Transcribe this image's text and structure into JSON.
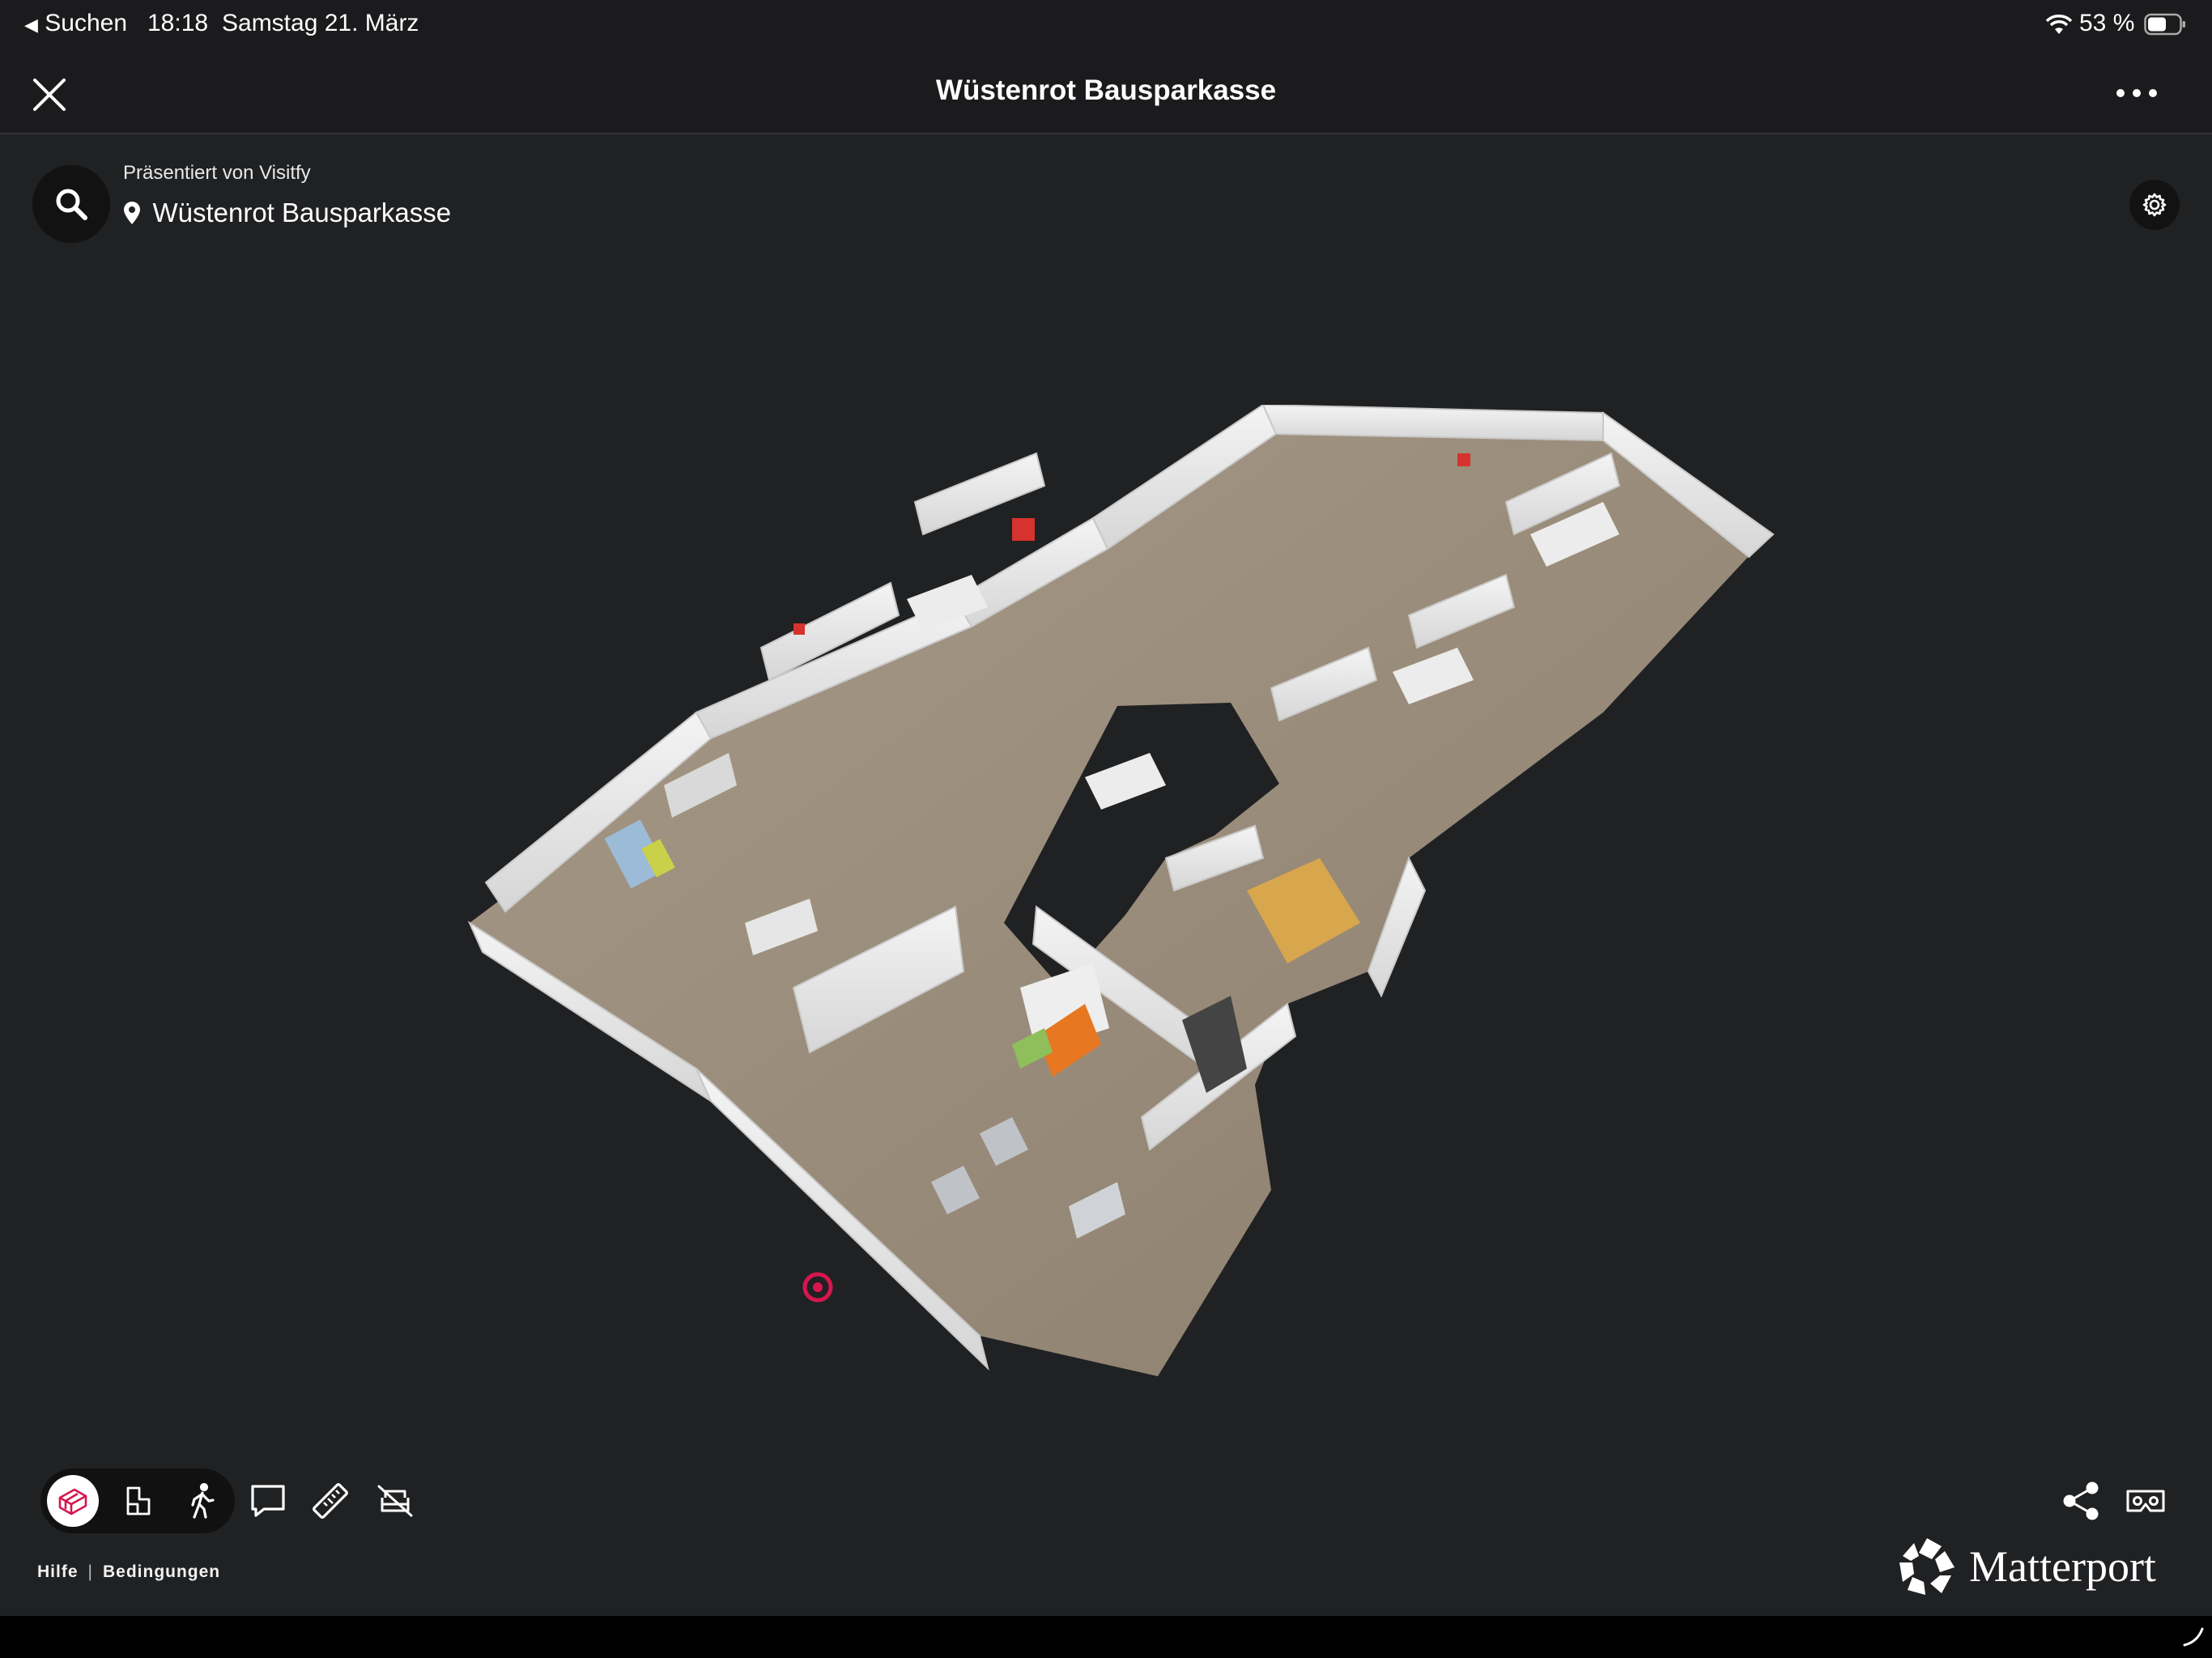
{
  "status_bar": {
    "back_label": "Suchen",
    "time": "18:18",
    "date": "Samstag 21. März",
    "battery": "53 %"
  },
  "nav": {
    "title": "Wüstenrot Bausparkasse"
  },
  "tour": {
    "presented_by": "Präsentiert von Visitfy",
    "location": "Wüstenrot Bausparkasse"
  },
  "toolbar": {
    "modes": [
      "dollhouse-icon",
      "floorplan-icon",
      "walk-icon"
    ],
    "active_mode": "dollhouse",
    "tools": [
      "comment-icon",
      "measure-icon",
      "furniture-hidden-icon"
    ],
    "right_tools": [
      "share-icon",
      "vr-icon"
    ]
  },
  "footer": {
    "help": "Hilfe",
    "separator": "|",
    "terms": "Bedingungen"
  },
  "branding": {
    "name": "Matterport"
  },
  "colors": {
    "accent": "#d6164e",
    "background": "#202123",
    "bar": "#1b1b1d"
  }
}
